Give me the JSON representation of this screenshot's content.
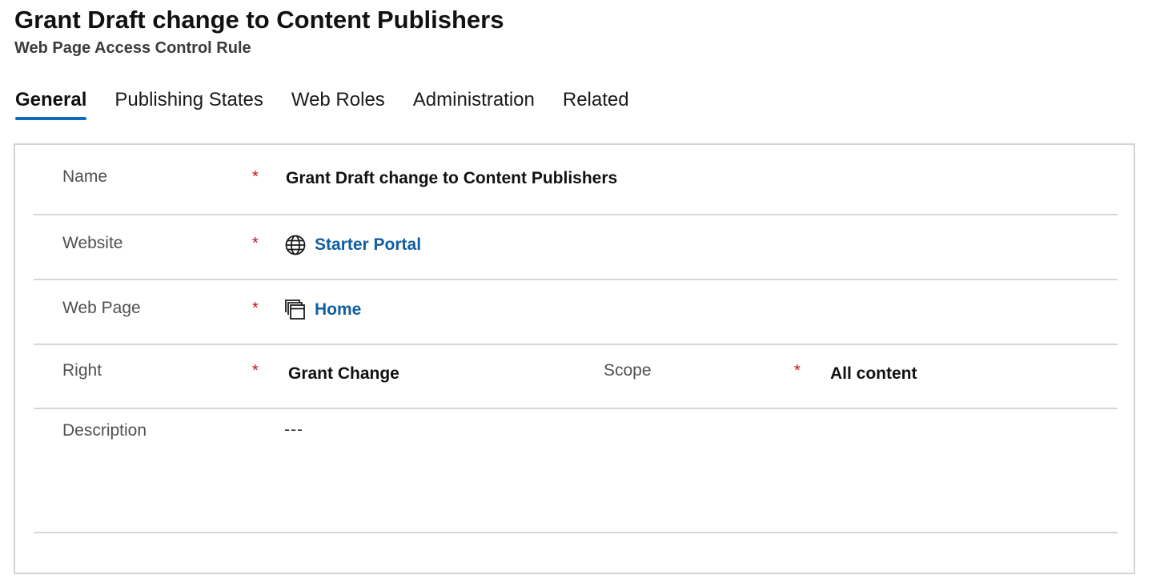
{
  "header": {
    "title": "Grant Draft change to Content Publishers",
    "subtitle": "Web Page Access Control Rule"
  },
  "tabs": [
    {
      "label": "General",
      "active": true
    },
    {
      "label": "Publishing States",
      "active": false
    },
    {
      "label": "Web Roles",
      "active": false
    },
    {
      "label": "Administration",
      "active": false
    },
    {
      "label": "Related",
      "active": false
    }
  ],
  "form": {
    "required_marker": "*",
    "name": {
      "label": "Name",
      "value": "Grant Draft change to Content Publishers"
    },
    "website": {
      "label": "Website",
      "value": "Starter Portal",
      "icon": "globe-icon"
    },
    "web_page": {
      "label": "Web Page",
      "value": "Home",
      "icon": "web-page-icon"
    },
    "right": {
      "label": "Right",
      "value": "Grant Change"
    },
    "scope": {
      "label": "Scope",
      "value": "All content"
    },
    "description": {
      "label": "Description",
      "value": "---"
    }
  },
  "colors": {
    "accent": "#0f6cbd",
    "link": "#115ea3",
    "required": "#c50f1f",
    "divider": "#d6d6d6"
  }
}
